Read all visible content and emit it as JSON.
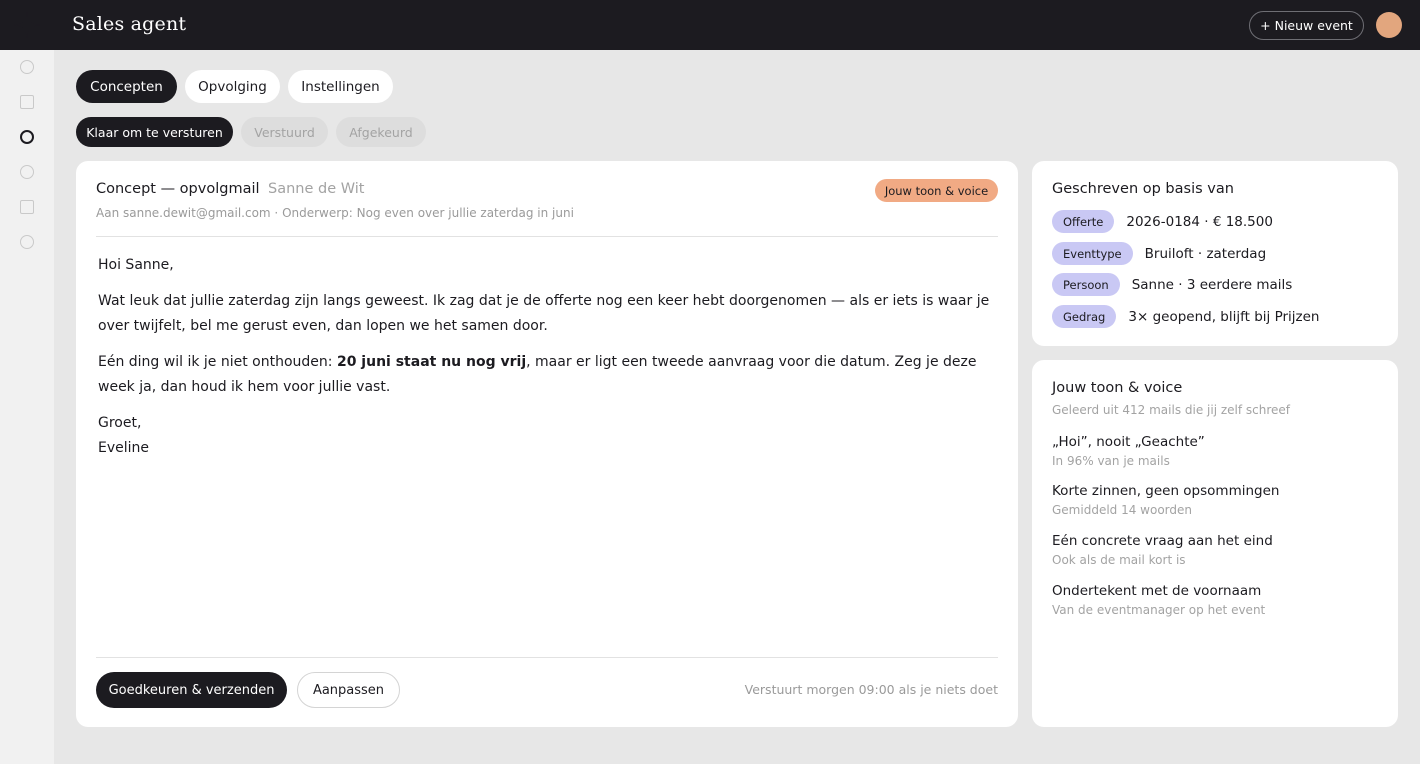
{
  "app": {
    "title": "Sales agent",
    "new_event_label": "+ Nieuw event"
  },
  "colors": {
    "dark": "#1c1b20",
    "accent_peach": "#f1aa84",
    "tag_lavender": "#c9c8f4",
    "avatar": "#e2a67e",
    "background": "#e7e7e7"
  },
  "sidebar": {
    "logo_icon": "sparkle-icon",
    "items": [
      {
        "icon": "circle-icon",
        "active": false
      },
      {
        "icon": "square-icon",
        "active": false
      },
      {
        "icon": "circle-icon",
        "active": true
      },
      {
        "icon": "circle-icon",
        "active": false
      },
      {
        "icon": "square-icon",
        "active": false
      },
      {
        "icon": "circle-icon",
        "active": false
      }
    ]
  },
  "tabs": [
    {
      "label": "Concepten",
      "active": true
    },
    {
      "label": "Opvolging",
      "active": false
    },
    {
      "label": "Instellingen",
      "active": false
    }
  ],
  "filters": [
    {
      "label": "Klaar om te versturen",
      "active": true
    },
    {
      "label": "Verstuurd",
      "active": false
    },
    {
      "label": "Afgekeurd",
      "active": false
    }
  ],
  "draft": {
    "title": "Concept — opvolgmail",
    "recipient_name": "Sanne de Wit",
    "voice_badge": "Jouw toon & voice",
    "meta": "Aan sanne.dewit@gmail.com · Onderwerp: Nog even over jullie zaterdag in juni",
    "greeting": "Hoi Sanne,",
    "paragraph1": "Wat leuk dat jullie zaterdag zijn langs geweest. Ik zag dat je de offerte nog een keer hebt doorgenomen — als er iets is waar je over twijfelt, bel me gerust even, dan lopen we het samen door.",
    "paragraph2_start": "Eén ding wil ik je niet onthouden: ",
    "paragraph2_bold": "20 juni staat nu nog vrij",
    "paragraph2_end": ", maar er ligt een tweede aanvraag voor die datum. Zeg je deze week ja, dan houd ik hem voor jullie vast.",
    "closing": "Groet,",
    "signature": "Eveline",
    "approve_label": "Goedkeuren & verzenden",
    "adjust_label": "Aanpassen",
    "send_note": "Verstuurt morgen 09:00 als je niets doet"
  },
  "based_on": {
    "title": "Geschreven op basis van",
    "items": [
      {
        "tag": "Offerte",
        "value": "2026-0184 · € 18.500"
      },
      {
        "tag": "Eventtype",
        "value": "Bruiloft · zaterdag"
      },
      {
        "tag": "Persoon",
        "value": "Sanne · 3 eerdere mails"
      },
      {
        "tag": "Gedrag",
        "value": "3× geopend, blijft bij Prijzen"
      }
    ]
  },
  "voice": {
    "title": "Jouw toon & voice",
    "subtitle": "Geleerd uit 412 mails die jij zelf schreef",
    "traits": [
      {
        "title": "„Hoi”, nooit „Geachte”",
        "sub": "In 96% van je mails"
      },
      {
        "title": "Korte zinnen, geen opsommingen",
        "sub": "Gemiddeld 14 woorden"
      },
      {
        "title": "Eén concrete vraag aan het eind",
        "sub": "Ook als de mail kort is"
      },
      {
        "title": "Ondertekent met de voornaam",
        "sub": "Van de eventmanager op het event"
      }
    ]
  }
}
